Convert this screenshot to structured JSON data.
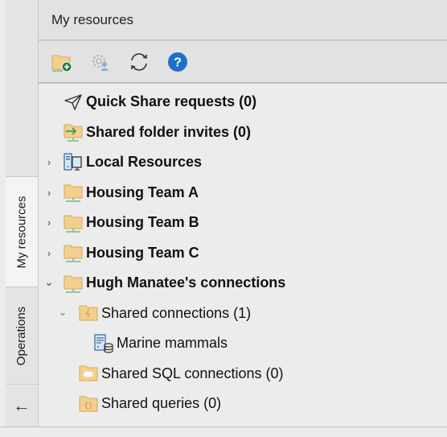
{
  "sidebar": {
    "tabs": [
      {
        "label": "My resources",
        "active": true
      },
      {
        "label": "Operations",
        "active": false
      }
    ],
    "collapse_icon": "arrow-left-icon",
    "collapse_glyph": "←"
  },
  "panel": {
    "title": "My resources",
    "toolbar": [
      {
        "name": "new-folder-button",
        "icon": "folder-add-icon"
      },
      {
        "name": "settings-user-button",
        "icon": "gear-user-icon",
        "disabled": true
      },
      {
        "name": "refresh-button",
        "icon": "refresh-icon"
      },
      {
        "name": "help-button",
        "icon": "help-icon",
        "glyph": "?"
      }
    ]
  },
  "tree": {
    "chevron_collapsed": "›",
    "chevron_expanded": "⌄",
    "items": [
      {
        "label": "Quick Share requests (0)",
        "icon": "paper-plane-icon",
        "level": 0,
        "expandable": false
      },
      {
        "label": "Shared folder invites (0)",
        "icon": "shared-folder-invite-icon",
        "level": 0,
        "expandable": false
      },
      {
        "label": "Local Resources",
        "icon": "computer-icon",
        "level": 0,
        "expandable": true,
        "expanded": false
      },
      {
        "label": "Housing Team A",
        "icon": "network-folder-icon",
        "level": 0,
        "expandable": true,
        "expanded": false
      },
      {
        "label": "Housing Team B",
        "icon": "network-folder-icon",
        "level": 0,
        "expandable": true,
        "expanded": false
      },
      {
        "label": "Housing Team C",
        "icon": "network-folder-icon",
        "level": 0,
        "expandable": true,
        "expanded": false
      },
      {
        "label": "Hugh Manatee's connections",
        "icon": "network-folder-icon",
        "level": 0,
        "expandable": true,
        "expanded": true
      },
      {
        "label": "Shared connections (1)",
        "icon": "connections-folder-icon",
        "level": 1,
        "expandable": true,
        "expanded": true
      },
      {
        "label": "Marine mammals",
        "icon": "database-connection-icon",
        "level": 2,
        "expandable": false
      },
      {
        "label": "Shared SQL connections (0)",
        "icon": "sql-folder-icon",
        "level": 1,
        "expandable": false
      },
      {
        "label": "Shared queries (0)",
        "icon": "queries-folder-icon",
        "level": 1,
        "expandable": false
      }
    ]
  },
  "colors": {
    "folder": "#f3cf8f",
    "folder_edge": "#d9a95a",
    "network": "#6fb889",
    "help_blue": "#1e6fc8",
    "add_green": "#2e7d4f"
  }
}
